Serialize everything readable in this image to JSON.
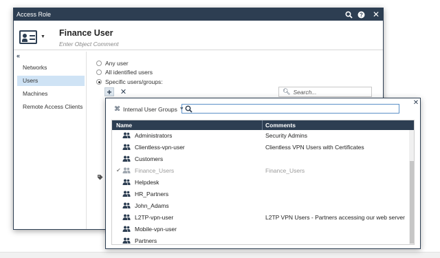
{
  "dialog": {
    "title": "Access Role",
    "object_name": "Finance User",
    "comment_placeholder": "Enter Object Comment",
    "collapse_glyph": "«"
  },
  "sidebar": {
    "items": [
      {
        "label": "Networks"
      },
      {
        "label": "Users"
      },
      {
        "label": "Machines"
      },
      {
        "label": "Remote Access Clients"
      }
    ]
  },
  "users_pane": {
    "options": [
      {
        "label": "Any user"
      },
      {
        "label": "All identified users"
      },
      {
        "label": "Specific users/groups:"
      }
    ],
    "add_glyph": "+",
    "remove_glyph": "✕",
    "search_placeholder": "Search..."
  },
  "picker": {
    "filter_label": "Internal User Groups",
    "columns": {
      "name": "Name",
      "comments": "Comments"
    },
    "rows": [
      {
        "name": "Administrators",
        "comment": "Security Admins"
      },
      {
        "name": "Clientless-vpn-user",
        "comment": "Clientless VPN Users with Certificates"
      },
      {
        "name": "Customers",
        "comment": ""
      },
      {
        "name": "Finance_Users",
        "comment": "Finance_Users",
        "selected_mark": "✔"
      },
      {
        "name": "Helpdesk",
        "comment": ""
      },
      {
        "name": "HR_Partners",
        "comment": ""
      },
      {
        "name": "John_Adams",
        "comment": ""
      },
      {
        "name": "L2TP-vpn-user",
        "comment": "L2TP VPN Users - Partners accessing our web server"
      },
      {
        "name": "Mobile-vpn-user",
        "comment": ""
      },
      {
        "name": "Partners",
        "comment": ""
      }
    ]
  },
  "colors": {
    "titlebar": "#2d3e52",
    "selection": "#cfe3f5",
    "search_focus": "#5a8fc7"
  },
  "icons": {
    "search": "search-icon",
    "help": "help-icon",
    "close": "close-icon",
    "group": "user-group-icon",
    "tag": "tag-icon"
  }
}
